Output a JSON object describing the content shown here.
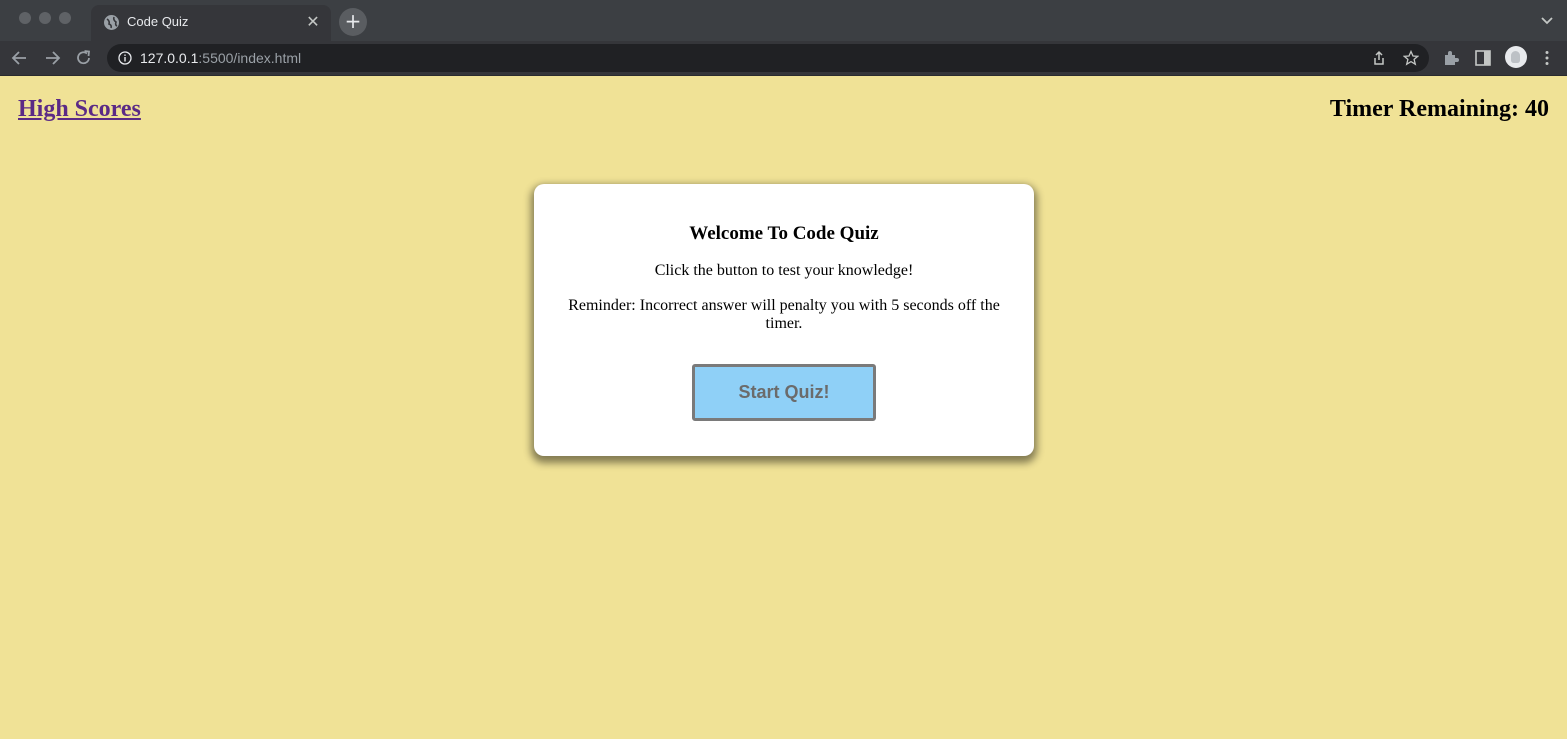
{
  "browser": {
    "tab_title": "Code Quiz",
    "tab_close": "✕",
    "new_tab": "+",
    "url_host": "127.0.0.1",
    "url_rest": ":5500/index.html"
  },
  "page": {
    "high_scores_label": "High Scores",
    "timer_label": "Timer Remaining: ",
    "timer_value": "40",
    "background_color": "#f0e296"
  },
  "card": {
    "title": "Welcome To Code Quiz",
    "intro": "Click the button to test your knowledge!",
    "reminder": "Reminder: Incorrect answer will penalty you with 5 seconds off the timer.",
    "start_button_label": "Start Quiz!",
    "button_color": "#8fd0f7"
  }
}
